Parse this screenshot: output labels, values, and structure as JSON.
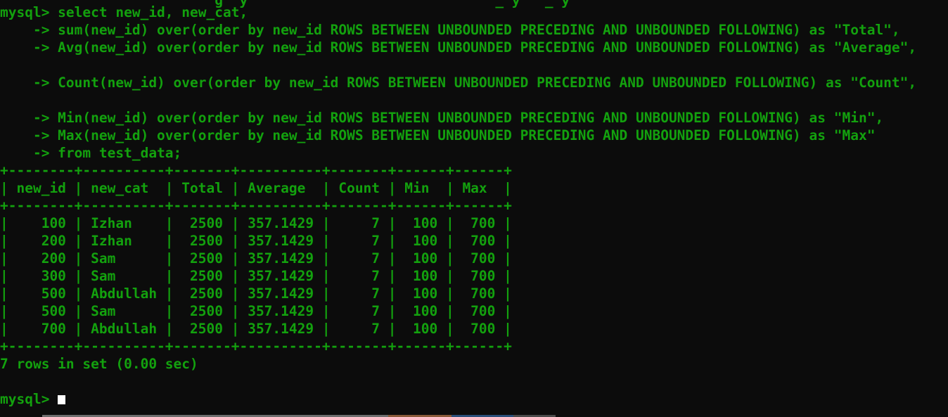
{
  "terminal": {
    "lines": [
      "                          g  y                              _ y   _ y",
      "mysql> select new_id, new_cat,",
      "    -> sum(new_id) over(order by new_id ROWS BETWEEN UNBOUNDED PRECEDING AND UNBOUNDED FOLLOWING) as \"Total\",",
      "    -> Avg(new_id) over(order by new_id ROWS BETWEEN UNBOUNDED PRECEDING AND UNBOUNDED FOLLOWING) as \"Average\",",
      "",
      "    -> Count(new_id) over(order by new_id ROWS BETWEEN UNBOUNDED PRECEDING AND UNBOUNDED FOLLOWING) as \"Count\",",
      "",
      "    -> Min(new_id) over(order by new_id ROWS BETWEEN UNBOUNDED PRECEDING AND UNBOUNDED FOLLOWING) as \"Min\",",
      "    -> Max(new_id) over(order by new_id ROWS BETWEEN UNBOUNDED PRECEDING AND UNBOUNDED FOLLOWING) as \"Max\"",
      "    -> from test_data;",
      "+--------+----------+-------+----------+-------+------+------+",
      "| new_id | new_cat  | Total | Average  | Count | Min  | Max  |",
      "+--------+----------+-------+----------+-------+------+------+",
      "|    100 | Izhan    |  2500 | 357.1429 |     7 |  100 |  700 |",
      "|    200 | Izhan    |  2500 | 357.1429 |     7 |  100 |  700 |",
      "|    200 | Sam      |  2500 | 357.1429 |     7 |  100 |  700 |",
      "|    300 | Sam      |  2500 | 357.1429 |     7 |  100 |  700 |",
      "|    500 | Abdullah |  2500 | 357.1429 |     7 |  100 |  700 |",
      "|    500 | Sam      |  2500 | 357.1429 |     7 |  100 |  700 |",
      "|    700 | Abdullah |  2500 | 357.1429 |     7 |  100 |  700 |",
      "+--------+----------+-------+----------+-------+------+------+",
      "7 rows in set (0.00 sec)",
      "",
      "mysql> "
    ],
    "colors": {
      "background": "#0c0c0c",
      "text": "#13a10e",
      "cursor": "#ffffff"
    }
  }
}
